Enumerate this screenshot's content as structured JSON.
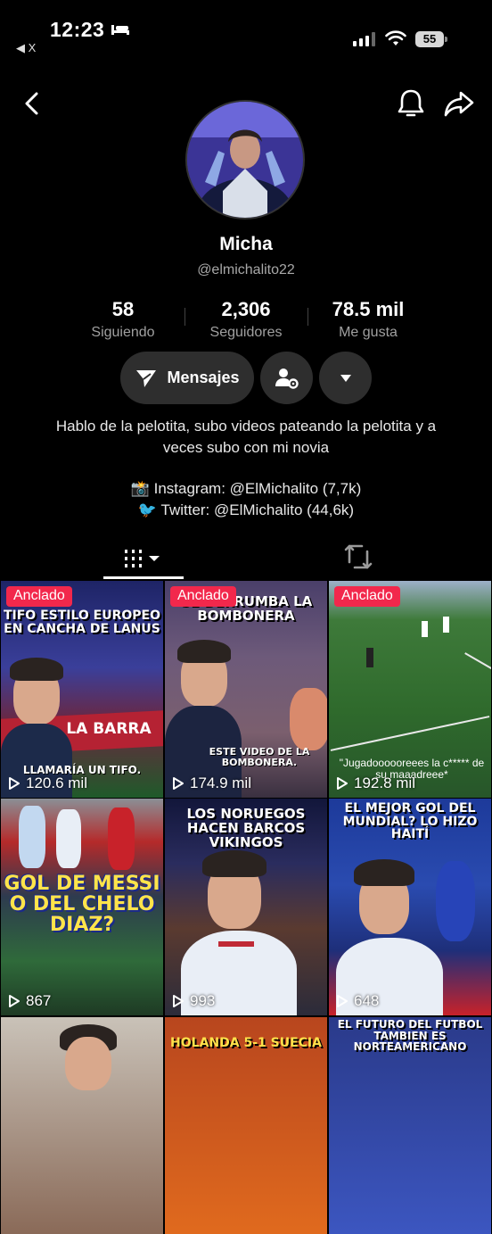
{
  "status_bar": {
    "time": "12:23",
    "back_app": "◀ X",
    "battery": "55"
  },
  "profile": {
    "name": "Micha",
    "handle": "@elmichalito22",
    "stats": [
      {
        "value": "58",
        "label": "Siguiendo"
      },
      {
        "value": "2,306",
        "label": "Seguidores"
      },
      {
        "value": "78.5 mil",
        "label": "Me gusta"
      }
    ],
    "message_button": "Mensajes",
    "bio": "Hablo de la pelotita, subo videos pateando la pelotita y a veces subo con mi novia",
    "social": [
      {
        "emoji": "📸",
        "text": "Instagram: @ElMichalito (7,7k)"
      },
      {
        "emoji": "🐦",
        "text": "Twitter: @ElMichalito (44,6k)"
      }
    ]
  },
  "icons": {
    "back": "chevron-left-icon",
    "bell": "bell-icon",
    "share": "share-arrow-icon",
    "message": "paper-plane-icon",
    "user_settings": "user-gear-icon",
    "more": "caret-down-icon",
    "grid_tab": "grid-icon",
    "repost_tab": "repost-icon",
    "play": "play-icon"
  },
  "colors": {
    "pin_badge": "#f2284c",
    "button_bg": "#2e2e2e",
    "background": "#000000"
  },
  "videos": [
    {
      "pinned_label": "Anclado",
      "views": "120.6 mil",
      "title": "TIFO ESTILO EUROPEO EN CANCHA DE LANUS",
      "caption": "LLAMARÍA UN TIFO.",
      "banner": "LA BARRA"
    },
    {
      "pinned_label": "Anclado",
      "views": "174.9 mil",
      "title": "SE DERRUMBA LA BOMBONERA",
      "caption": "ESTE VIDEO DE LA BOMBONERA."
    },
    {
      "pinned_label": "Anclado",
      "views": "192.8 mil",
      "caption": "\"Jugadoooooreees la c***** de su maaadreee*"
    },
    {
      "views": "867",
      "title": "GOL DE MESSI O DEL CHELO DIAZ?"
    },
    {
      "views": "993",
      "title": "LOS NORUEGOS HACEN BARCOS VIKINGOS"
    },
    {
      "views": "648",
      "title": "EL MEJOR GOL DEL MUNDIAL? LO HIZO HAITÍ"
    },
    {
      "title": ""
    },
    {
      "title": "HOLANDA 5-1 SUECIA"
    },
    {
      "title": "EL FUTURO DEL FUTBOL TAMBIEN ES NORTEAMERICANO"
    }
  ]
}
